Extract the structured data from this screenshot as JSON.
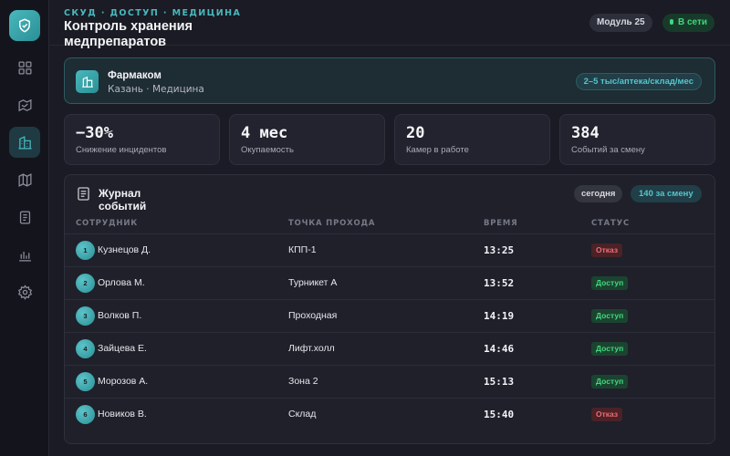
{
  "app": {
    "breadcrumb": "СКУД · ДОСТУП · МЕДИЦИНА",
    "title": "Контроль хранения медпрепаратов",
    "module_badge": "Модуль 25",
    "online_badge": "В сети",
    "accent_color": "#49b8bd"
  },
  "sidebar": {
    "items": [
      {
        "icon": "dashboard-icon"
      },
      {
        "icon": "map-route-icon"
      },
      {
        "icon": "building-icon",
        "active": true
      },
      {
        "icon": "map-icon"
      },
      {
        "icon": "document-icon"
      },
      {
        "icon": "bar-chart-icon"
      },
      {
        "icon": "gear-icon"
      }
    ]
  },
  "org": {
    "name": "Фармаком",
    "subtitle": "Казань · Медицина",
    "badge": "2–5 тыс/аптека/склад/мес"
  },
  "stats": [
    {
      "value": "−30%",
      "label": "Снижение инцидентов"
    },
    {
      "value": "4 мес",
      "label": "Окупаемость"
    },
    {
      "value": "20",
      "label": "Камер в работе"
    },
    {
      "value": "384",
      "label": "Событий за смену"
    }
  ],
  "journal": {
    "title": "Журнал событий",
    "today_label": "сегодня",
    "count_label": "140 за смену",
    "columns": [
      "СОТРУДНИК",
      "ТОЧКА ПРОХОДА",
      "ВРЕМЯ",
      "СТАТУС"
    ],
    "rows": [
      {
        "num": "1",
        "name": "Кузнецов Д.",
        "point": "КПП-1",
        "time": "13:25",
        "status": "Отказ",
        "ok": false
      },
      {
        "num": "2",
        "name": "Орлова М.",
        "point": "Турникет А",
        "time": "13:52",
        "status": "Доступ",
        "ok": true
      },
      {
        "num": "3",
        "name": "Волков П.",
        "point": "Проходная",
        "time": "14:19",
        "status": "Доступ",
        "ok": true
      },
      {
        "num": "4",
        "name": "Зайцева Е.",
        "point": "Лифт.холл",
        "time": "14:46",
        "status": "Доступ",
        "ok": true
      },
      {
        "num": "5",
        "name": "Морозов А.",
        "point": "Зона 2",
        "time": "15:13",
        "status": "Доступ",
        "ok": true
      },
      {
        "num": "6",
        "name": "Новиков В.",
        "point": "Склад",
        "time": "15:40",
        "status": "Отказ",
        "ok": false
      }
    ]
  }
}
